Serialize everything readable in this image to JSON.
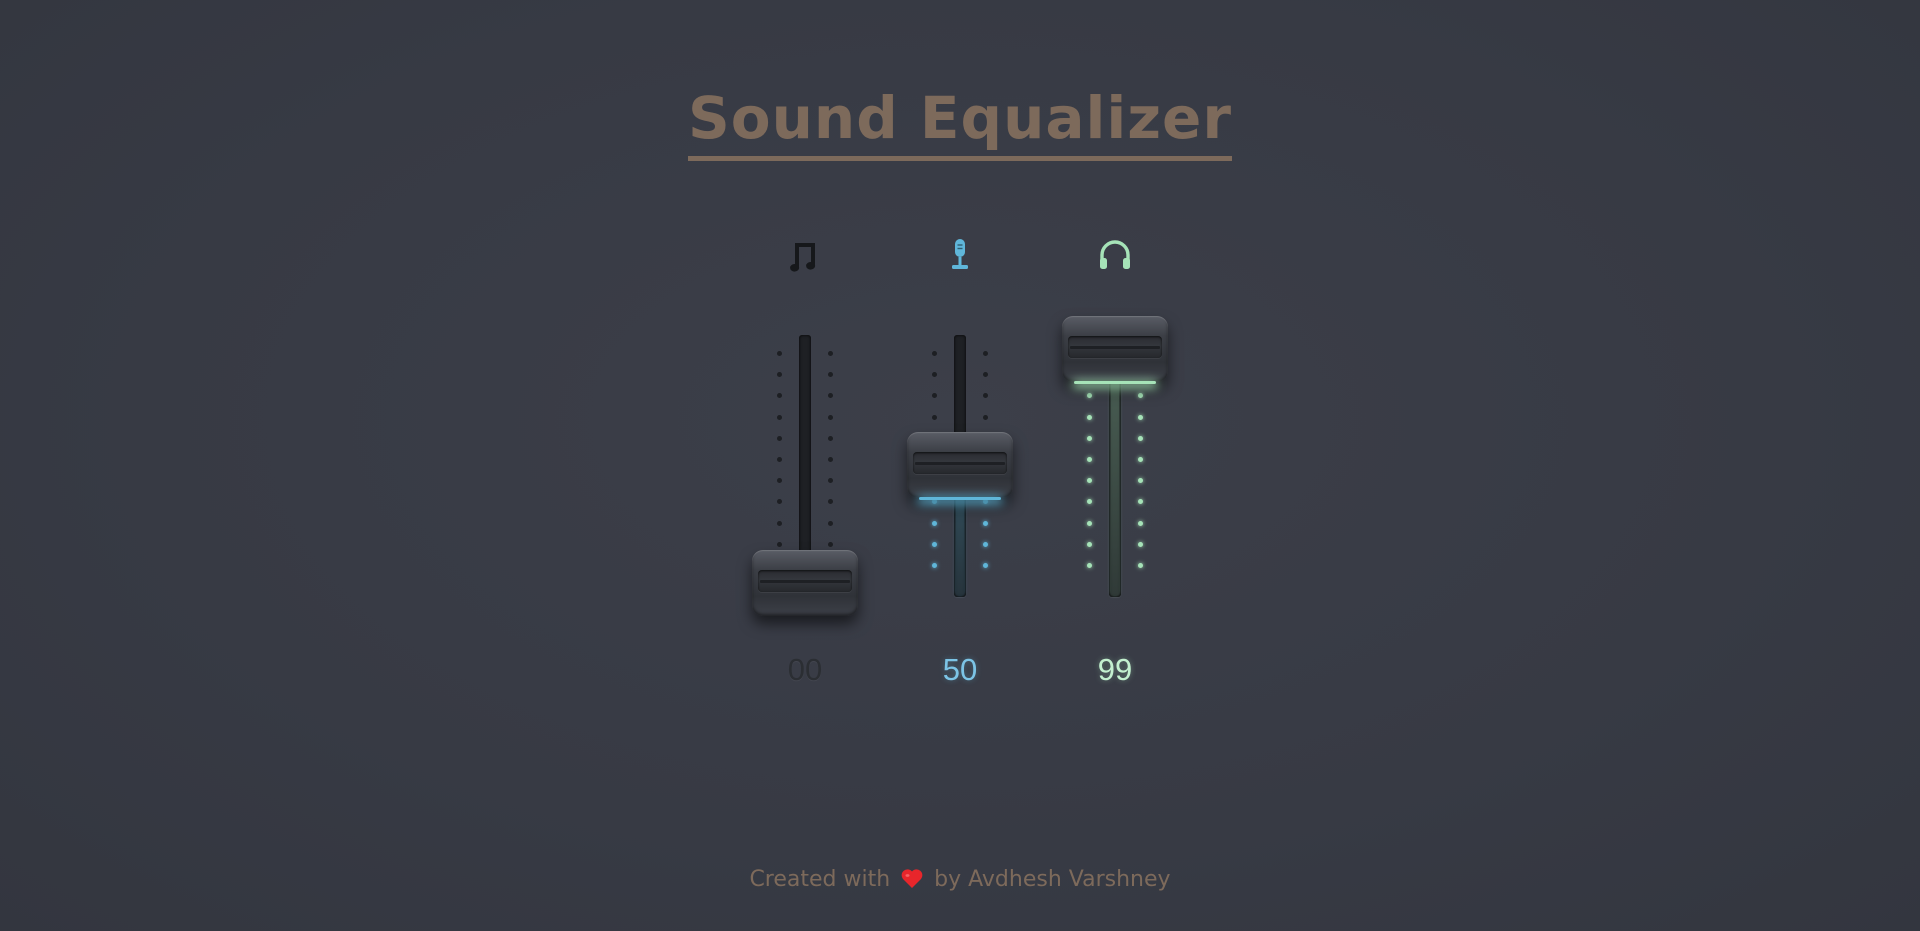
{
  "header": {
    "title": "Sound Equalizer"
  },
  "channels": [
    {
      "name": "music",
      "icon": "music-note-icon",
      "value": 0,
      "value_label": "00",
      "accent": "#1e2024",
      "value_color": "#2b2e33"
    },
    {
      "name": "microphone",
      "icon": "microphone-icon",
      "value": 50,
      "value_label": "50",
      "accent": "#5fb6d9",
      "value_color": "#7cc4e6"
    },
    {
      "name": "headphones",
      "icon": "headphones-icon",
      "value": 99,
      "value_label": "99",
      "accent": "#a6e3b8",
      "value_color": "#c3f0cf"
    }
  ],
  "footer": {
    "prefix": "Created with",
    "heart_icon": "heart-icon",
    "suffix": "by Avdhesh Varshney"
  },
  "colors": {
    "background": "#393c46",
    "title": "#7d6a5b",
    "heart": "#e8262b"
  }
}
